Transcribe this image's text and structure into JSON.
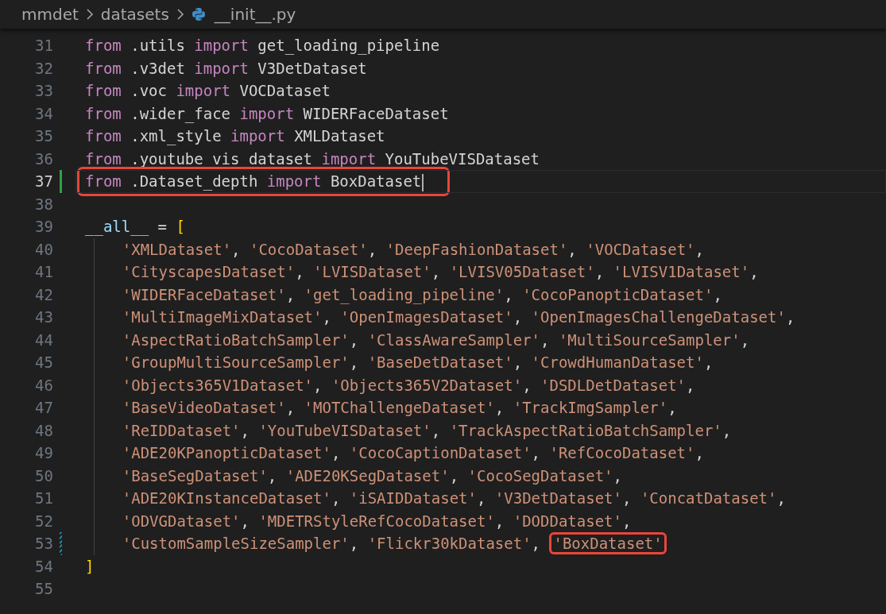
{
  "breadcrumb": [
    {
      "text": "mmdet",
      "kind": "folder"
    },
    {
      "text": "datasets",
      "kind": "folder"
    },
    {
      "text": "__init__.py",
      "kind": "python-file"
    }
  ],
  "lines": [
    {
      "number": "31",
      "kind": "unchanged",
      "indented": false,
      "tokens": [
        {
          "kind": "keyword",
          "text": "from"
        },
        {
          "kind": "plain",
          "text": " .utils "
        },
        {
          "kind": "keyword",
          "text": "import"
        },
        {
          "kind": "plain",
          "text": " get_loading_pipeline"
        }
      ]
    },
    {
      "number": "32",
      "kind": "unchanged",
      "indented": false,
      "tokens": [
        {
          "kind": "keyword",
          "text": "from"
        },
        {
          "kind": "plain",
          "text": " .v3det "
        },
        {
          "kind": "keyword",
          "text": "import"
        },
        {
          "kind": "plain",
          "text": " V3DetDataset"
        }
      ]
    },
    {
      "number": "33",
      "kind": "unchanged",
      "indented": false,
      "tokens": [
        {
          "kind": "keyword",
          "text": "from"
        },
        {
          "kind": "plain",
          "text": " .voc "
        },
        {
          "kind": "keyword",
          "text": "import"
        },
        {
          "kind": "plain",
          "text": " VOCDataset"
        }
      ]
    },
    {
      "number": "34",
      "kind": "unchanged",
      "indented": false,
      "tokens": [
        {
          "kind": "keyword",
          "text": "from"
        },
        {
          "kind": "plain",
          "text": " .wider_face "
        },
        {
          "kind": "keyword",
          "text": "import"
        },
        {
          "kind": "plain",
          "text": " WIDERFaceDataset"
        }
      ]
    },
    {
      "number": "35",
      "kind": "unchanged",
      "indented": false,
      "tokens": [
        {
          "kind": "keyword",
          "text": "from"
        },
        {
          "kind": "plain",
          "text": " .xml_style "
        },
        {
          "kind": "keyword",
          "text": "import"
        },
        {
          "kind": "plain",
          "text": " XMLDataset"
        }
      ]
    },
    {
      "number": "36",
      "kind": "unchanged",
      "indented": false,
      "tokens": [
        {
          "kind": "keyword",
          "text": "from"
        },
        {
          "kind": "plain",
          "text": " .youtube vis dataset "
        },
        {
          "kind": "keyword",
          "text": "import"
        },
        {
          "kind": "plain",
          "text": " YouTubeVISDataset"
        }
      ]
    },
    {
      "number": "37",
      "kind": "added",
      "indented": false,
      "current": true,
      "cursor": true,
      "annotated": true,
      "tokens": [
        {
          "kind": "keyword",
          "text": "from"
        },
        {
          "kind": "plain",
          "text": " .Dataset_depth "
        },
        {
          "kind": "keyword",
          "text": "import"
        },
        {
          "kind": "plain",
          "text": " BoxDataset"
        }
      ]
    },
    {
      "number": "38",
      "kind": "unchanged",
      "indented": false
    },
    {
      "number": "39",
      "kind": "unchanged",
      "indented": false,
      "tokens": [
        {
          "kind": "variable",
          "text": "__all__"
        },
        {
          "kind": "plain",
          "text": " = "
        },
        {
          "kind": "bracket",
          "text": "["
        }
      ]
    },
    {
      "number": "40",
      "kind": "unchanged",
      "indented": true,
      "tokens": [
        {
          "kind": "string",
          "text": "'XMLDataset'"
        },
        {
          "kind": "plain",
          "text": ", "
        },
        {
          "kind": "string",
          "text": "'CocoDataset'"
        },
        {
          "kind": "plain",
          "text": ", "
        },
        {
          "kind": "string",
          "text": "'DeepFashionDataset'"
        },
        {
          "kind": "plain",
          "text": ", "
        },
        {
          "kind": "string",
          "text": "'VOCDataset'"
        },
        {
          "kind": "plain",
          "text": ","
        }
      ]
    },
    {
      "number": "41",
      "kind": "unchanged",
      "indented": true,
      "tokens": [
        {
          "kind": "string",
          "text": "'CityscapesDataset'"
        },
        {
          "kind": "plain",
          "text": ", "
        },
        {
          "kind": "string",
          "text": "'LVISDataset'"
        },
        {
          "kind": "plain",
          "text": ", "
        },
        {
          "kind": "string",
          "text": "'LVISV05Dataset'"
        },
        {
          "kind": "plain",
          "text": ", "
        },
        {
          "kind": "string",
          "text": "'LVISV1Dataset'"
        },
        {
          "kind": "plain",
          "text": ","
        }
      ]
    },
    {
      "number": "42",
      "kind": "unchanged",
      "indented": true,
      "tokens": [
        {
          "kind": "string",
          "text": "'WIDERFaceDataset'"
        },
        {
          "kind": "plain",
          "text": ", "
        },
        {
          "kind": "string",
          "text": "'get_loading_pipeline'"
        },
        {
          "kind": "plain",
          "text": ", "
        },
        {
          "kind": "string",
          "text": "'CocoPanopticDataset'"
        },
        {
          "kind": "plain",
          "text": ","
        }
      ]
    },
    {
      "number": "43",
      "kind": "unchanged",
      "indented": true,
      "tokens": [
        {
          "kind": "string",
          "text": "'MultiImageMixDataset'"
        },
        {
          "kind": "plain",
          "text": ", "
        },
        {
          "kind": "string",
          "text": "'OpenImagesDataset'"
        },
        {
          "kind": "plain",
          "text": ", "
        },
        {
          "kind": "string",
          "text": "'OpenImagesChallengeDataset'"
        },
        {
          "kind": "plain",
          "text": ","
        }
      ]
    },
    {
      "number": "44",
      "kind": "unchanged",
      "indented": true,
      "tokens": [
        {
          "kind": "string",
          "text": "'AspectRatioBatchSampler'"
        },
        {
          "kind": "plain",
          "text": ", "
        },
        {
          "kind": "string",
          "text": "'ClassAwareSampler'"
        },
        {
          "kind": "plain",
          "text": ", "
        },
        {
          "kind": "string",
          "text": "'MultiSourceSampler'"
        },
        {
          "kind": "plain",
          "text": ","
        }
      ]
    },
    {
      "number": "45",
      "kind": "unchanged",
      "indented": true,
      "tokens": [
        {
          "kind": "string",
          "text": "'GroupMultiSourceSampler'"
        },
        {
          "kind": "plain",
          "text": ", "
        },
        {
          "kind": "string",
          "text": "'BaseDetDataset'"
        },
        {
          "kind": "plain",
          "text": ", "
        },
        {
          "kind": "string",
          "text": "'CrowdHumanDataset'"
        },
        {
          "kind": "plain",
          "text": ","
        }
      ]
    },
    {
      "number": "46",
      "kind": "unchanged",
      "indented": true,
      "tokens": [
        {
          "kind": "string",
          "text": "'Objects365V1Dataset'"
        },
        {
          "kind": "plain",
          "text": ", "
        },
        {
          "kind": "string",
          "text": "'Objects365V2Dataset'"
        },
        {
          "kind": "plain",
          "text": ", "
        },
        {
          "kind": "string",
          "text": "'DSDLDetDataset'"
        },
        {
          "kind": "plain",
          "text": ","
        }
      ]
    },
    {
      "number": "47",
      "kind": "unchanged",
      "indented": true,
      "tokens": [
        {
          "kind": "string",
          "text": "'BaseVideoDataset'"
        },
        {
          "kind": "plain",
          "text": ", "
        },
        {
          "kind": "string",
          "text": "'MOTChallengeDataset'"
        },
        {
          "kind": "plain",
          "text": ", "
        },
        {
          "kind": "string",
          "text": "'TrackImgSampler'"
        },
        {
          "kind": "plain",
          "text": ","
        }
      ]
    },
    {
      "number": "48",
      "kind": "unchanged",
      "indented": true,
      "tokens": [
        {
          "kind": "string",
          "text": "'ReIDDataset'"
        },
        {
          "kind": "plain",
          "text": ", "
        },
        {
          "kind": "string",
          "text": "'YouTubeVISDataset'"
        },
        {
          "kind": "plain",
          "text": ", "
        },
        {
          "kind": "string",
          "text": "'TrackAspectRatioBatchSampler'"
        },
        {
          "kind": "plain",
          "text": ","
        }
      ]
    },
    {
      "number": "49",
      "kind": "unchanged",
      "indented": true,
      "tokens": [
        {
          "kind": "string",
          "text": "'ADE20KPanopticDataset'"
        },
        {
          "kind": "plain",
          "text": ", "
        },
        {
          "kind": "string",
          "text": "'CocoCaptionDataset'"
        },
        {
          "kind": "plain",
          "text": ", "
        },
        {
          "kind": "string",
          "text": "'RefCocoDataset'"
        },
        {
          "kind": "plain",
          "text": ","
        }
      ]
    },
    {
      "number": "50",
      "kind": "unchanged",
      "indented": true,
      "tokens": [
        {
          "kind": "string",
          "text": "'BaseSegDataset'"
        },
        {
          "kind": "plain",
          "text": ", "
        },
        {
          "kind": "string",
          "text": "'ADE20KSegDataset'"
        },
        {
          "kind": "plain",
          "text": ", "
        },
        {
          "kind": "string",
          "text": "'CocoSegDataset'"
        },
        {
          "kind": "plain",
          "text": ","
        }
      ]
    },
    {
      "number": "51",
      "kind": "unchanged",
      "indented": true,
      "tokens": [
        {
          "kind": "string",
          "text": "'ADE20KInstanceDataset'"
        },
        {
          "kind": "plain",
          "text": ", "
        },
        {
          "kind": "string",
          "text": "'iSAIDDataset'"
        },
        {
          "kind": "plain",
          "text": ", "
        },
        {
          "kind": "string",
          "text": "'V3DetDataset'"
        },
        {
          "kind": "plain",
          "text": ", "
        },
        {
          "kind": "string",
          "text": "'ConcatDataset'"
        },
        {
          "kind": "plain",
          "text": ","
        }
      ]
    },
    {
      "number": "52",
      "kind": "unchanged",
      "indented": true,
      "tokens": [
        {
          "kind": "string",
          "text": "'ODVGDataset'"
        },
        {
          "kind": "plain",
          "text": ", "
        },
        {
          "kind": "string",
          "text": "'MDETRStyleRefCocoDataset'"
        },
        {
          "kind": "plain",
          "text": ", "
        },
        {
          "kind": "string",
          "text": "'DODDataset'"
        },
        {
          "kind": "plain",
          "text": ","
        }
      ]
    },
    {
      "number": "53",
      "kind": "modified",
      "indented": true,
      "tokens": [
        {
          "kind": "string",
          "text": "'CustomSampleSizeSampler'"
        },
        {
          "kind": "plain",
          "text": ", "
        },
        {
          "kind": "string",
          "text": "'Flickr30kDataset'"
        },
        {
          "kind": "plain",
          "text": ", "
        },
        {
          "kind": "string",
          "text": "'BoxDataset'",
          "annotated": true
        }
      ]
    },
    {
      "number": "54",
      "kind": "unchanged",
      "indented": false,
      "tokens": [
        {
          "kind": "bracket",
          "text": "]"
        }
      ]
    },
    {
      "number": "55",
      "kind": "unchanged",
      "indented": false
    }
  ]
}
